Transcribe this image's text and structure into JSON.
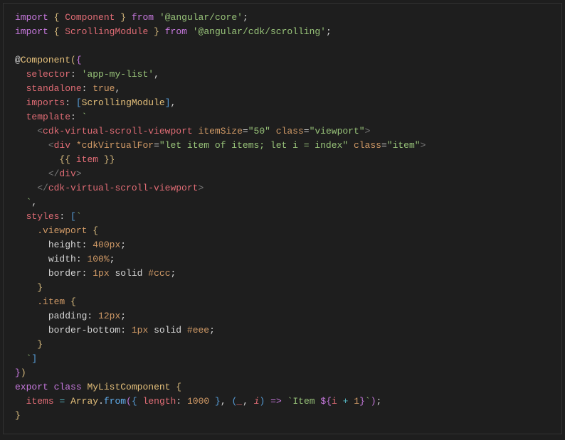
{
  "code": {
    "l1": {
      "import": "import",
      "ob": "{",
      "Component": "Component",
      "cb": "}",
      "from": "from",
      "pkg": "'@angular/core'",
      "semi": ";"
    },
    "l2": {
      "import": "import",
      "ob": "{",
      "ScrollingModule": "ScrollingModule",
      "cb": "}",
      "from": "from",
      "pkg": "'@angular/cdk/scrolling'",
      "semi": ";"
    },
    "l4": {
      "at": "@",
      "Component": "Component",
      "op": "(",
      "ob": "{"
    },
    "l5": {
      "selector": "selector",
      "colon": ":",
      "val": "'app-my-list'",
      "comma": ","
    },
    "l6": {
      "standalone": "standalone",
      "colon": ":",
      "val": "true",
      "comma": ","
    },
    "l7": {
      "imports": "imports",
      "colon": ":",
      "ob": "[",
      "ScrollingModule": "ScrollingModule",
      "cb": "]",
      "comma": ","
    },
    "l8": {
      "template": "template",
      "colon": ":",
      "tick": "`"
    },
    "l9": {
      "lt": "<",
      "tag": "cdk-virtual-scroll-viewport",
      "attr1": "itemSize",
      "eq": "=",
      "val1": "\"50\"",
      "attr2": "class",
      "val2": "\"viewport\"",
      "gt": ">"
    },
    "l10": {
      "lt": "<",
      "tag": "div",
      "attr1": "*cdkVirtualFor",
      "eq": "=",
      "val1": "\"let item of items; let i = index\"",
      "attr2": "class",
      "val2": "\"item\"",
      "gt": ">"
    },
    "l11": {
      "ob": "{{",
      "item": "item",
      "cb": "}}"
    },
    "l12": {
      "lt": "</",
      "tag": "div",
      "gt": ">"
    },
    "l13": {
      "lt": "</",
      "tag": "cdk-virtual-scroll-viewport",
      "gt": ">"
    },
    "l14": {
      "tick": "`",
      "comma": ","
    },
    "l15": {
      "styles": "styles",
      "colon": ":",
      "ob": "[",
      "tick": "`"
    },
    "l16": {
      "selector": ".viewport",
      "ob": "{"
    },
    "l17": {
      "prop": "height",
      "colon": ":",
      "val": "400px",
      "semi": ";"
    },
    "l18": {
      "prop": "width",
      "colon": ":",
      "val": "100%",
      "semi": ";"
    },
    "l19": {
      "prop": "border",
      "colon": ":",
      "v1": "1px",
      "v2": "solid",
      "v3": "#ccc",
      "semi": ";"
    },
    "l20": {
      "cb": "}"
    },
    "l21": {
      "selector": ".item",
      "ob": "{"
    },
    "l22": {
      "prop": "padding",
      "colon": ":",
      "val": "12px",
      "semi": ";"
    },
    "l23": {
      "prop": "border-bottom",
      "colon": ":",
      "v1": "1px",
      "v2": "solid",
      "v3": "#eee",
      "semi": ";"
    },
    "l24": {
      "cb": "}"
    },
    "l25": {
      "tick": "`",
      "cb": "]"
    },
    "l26": {
      "cb": "}",
      "cp": ")"
    },
    "l27": {
      "export": "export",
      "class": "class",
      "name": "MyListComponent",
      "ob": "{"
    },
    "l28": {
      "items": "items",
      "eq": "=",
      "Array": "Array",
      "dot": ".",
      "from": "from",
      "op": "(",
      "ob": "{",
      "length": "length",
      "colon": ":",
      "num": "1000",
      "cb": "}",
      "comma": ",",
      "ob2": "(",
      "p1": "_",
      "p2": "i",
      "cb2": ")",
      "arrow": "=>",
      "tick1": "`",
      "txt1": "Item ",
      "dol": "${",
      "i": "i",
      "plus": "+",
      "one": "1",
      "cbr": "}",
      "tick2": "`",
      "cp": ")",
      "semi": ";"
    },
    "l29": {
      "cb": "}"
    }
  }
}
